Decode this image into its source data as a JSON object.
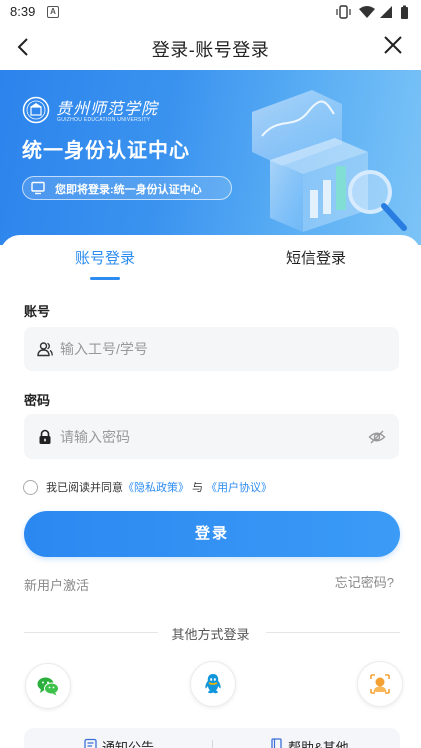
{
  "status_bar": {
    "time": "8:39",
    "indicator": "A",
    "icons": [
      "vibrate-icon",
      "wifi-icon",
      "signal-icon",
      "battery-icon"
    ]
  },
  "nav": {
    "title": "登录-账号登录",
    "back_icon": "chevron-left-icon",
    "close_icon": "close-icon"
  },
  "banner": {
    "school_name": "贵州师范学院",
    "school_name_en": "GUIZHOU EDUCATION UNIVERSITY",
    "heading": "统一身份认证中心",
    "notice": "您即将登录:统一身份认证中心",
    "notice_icon": "monitor-icon"
  },
  "tabs": [
    {
      "label": "账号登录",
      "active": true
    },
    {
      "label": "短信登录",
      "active": false
    }
  ],
  "form": {
    "account": {
      "label": "账号",
      "placeholder": "输入工号/学号",
      "value": "",
      "icon": "user-icon"
    },
    "password": {
      "label": "密码",
      "placeholder": "请输入密码",
      "value": "",
      "icon": "lock-icon",
      "toggle_icon": "eye-off-icon"
    }
  },
  "agreement": {
    "checked": false,
    "prefix": "我已阅读并同意",
    "privacy": "《隐私政策》",
    "conjunction": "与",
    "terms": "《用户协议》"
  },
  "actions": {
    "login_label": "登录",
    "activate_label": "新用户激活",
    "forgot_label": "忘记密码?"
  },
  "other_login": {
    "title": "其他方式登录",
    "methods": [
      {
        "icon": "wechat-icon"
      },
      {
        "icon": "qq-icon"
      },
      {
        "icon": "face-recognition-icon"
      }
    ]
  },
  "bottom_bar": {
    "items": [
      {
        "label": "通知公告",
        "icon": "notice-icon"
      },
      {
        "label": "帮助&其他",
        "icon": "help-icon"
      }
    ]
  },
  "colors": {
    "primary": "#2d8cf0",
    "banner_from": "#2c83ec",
    "banner_to": "#7cc4f7",
    "wechat": "#2aae3c",
    "qq": "#1296db",
    "face": "#f5a033"
  }
}
